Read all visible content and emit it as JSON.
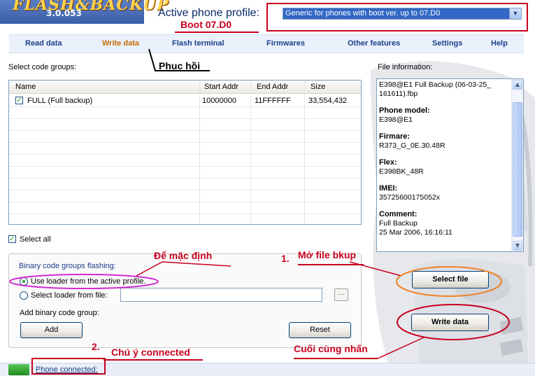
{
  "app": {
    "version": "3.0.053",
    "profile_label": "Active phone profile:",
    "profile_value": "Generic for phones with boot ver. up to 07.D0"
  },
  "menu": [
    "Read data",
    "Write data",
    "Flash terminal",
    "Firmwares",
    "Other features",
    "Settings",
    "Help"
  ],
  "main": {
    "select_groups_label": "Select code groups:",
    "table": {
      "headers": [
        "Name",
        "Start Addr",
        "End Addr",
        "Size"
      ],
      "rows": [
        {
          "name": "FULL (Full backup)",
          "start": "10000000",
          "end": "11FFFFFF",
          "size": "33,554,432",
          "checked": true
        }
      ]
    },
    "select_all": "Select all"
  },
  "file_info": {
    "label": "File information:",
    "file_name_1": "E398@E1 Full Backup (06-03-25_",
    "file_name_2": "161611).fbp",
    "phone_model_label": "Phone model:",
    "phone_model": "E398@E1",
    "firmware_label": "Firmare:",
    "firmware": "R373_G_0E.30.48R",
    "flex_label": "Flex:",
    "flex": "E398BK_48R",
    "imei_label": "IMEI:",
    "imei": "35725600175052x",
    "comment_label": "Comment:",
    "comment_1": "Full Backup",
    "comment_2": "25 Mar 2006, 16:16:11"
  },
  "binary": {
    "title": "Binary code groups flashing:",
    "use_loader": "Use loader from the active profile.",
    "select_loader": "Select loader from file:",
    "browse": "...",
    "add_group": "Add binary code group:",
    "add_btn": "Add",
    "reset_btn": "Reset"
  },
  "buttons": {
    "select_file": "Select file",
    "write_data": "Write data"
  },
  "status": {
    "text": "Phone connected:"
  },
  "annotations": {
    "boot": "Boot 07.D0",
    "restore": "Phuc hồi",
    "default": "Để mặc định",
    "step1_num": "1.",
    "open_backup": "Mở file bkup",
    "step2_num": "2.",
    "check_connected": "Chú ý connected",
    "finally_press": "Cuối cùng nhấn"
  },
  "colors": {
    "annotation": "#c8001e",
    "menu_text": "#1d3f8a",
    "highlight_magenta": "#d22bd2",
    "highlight_orange": "#f08020"
  }
}
